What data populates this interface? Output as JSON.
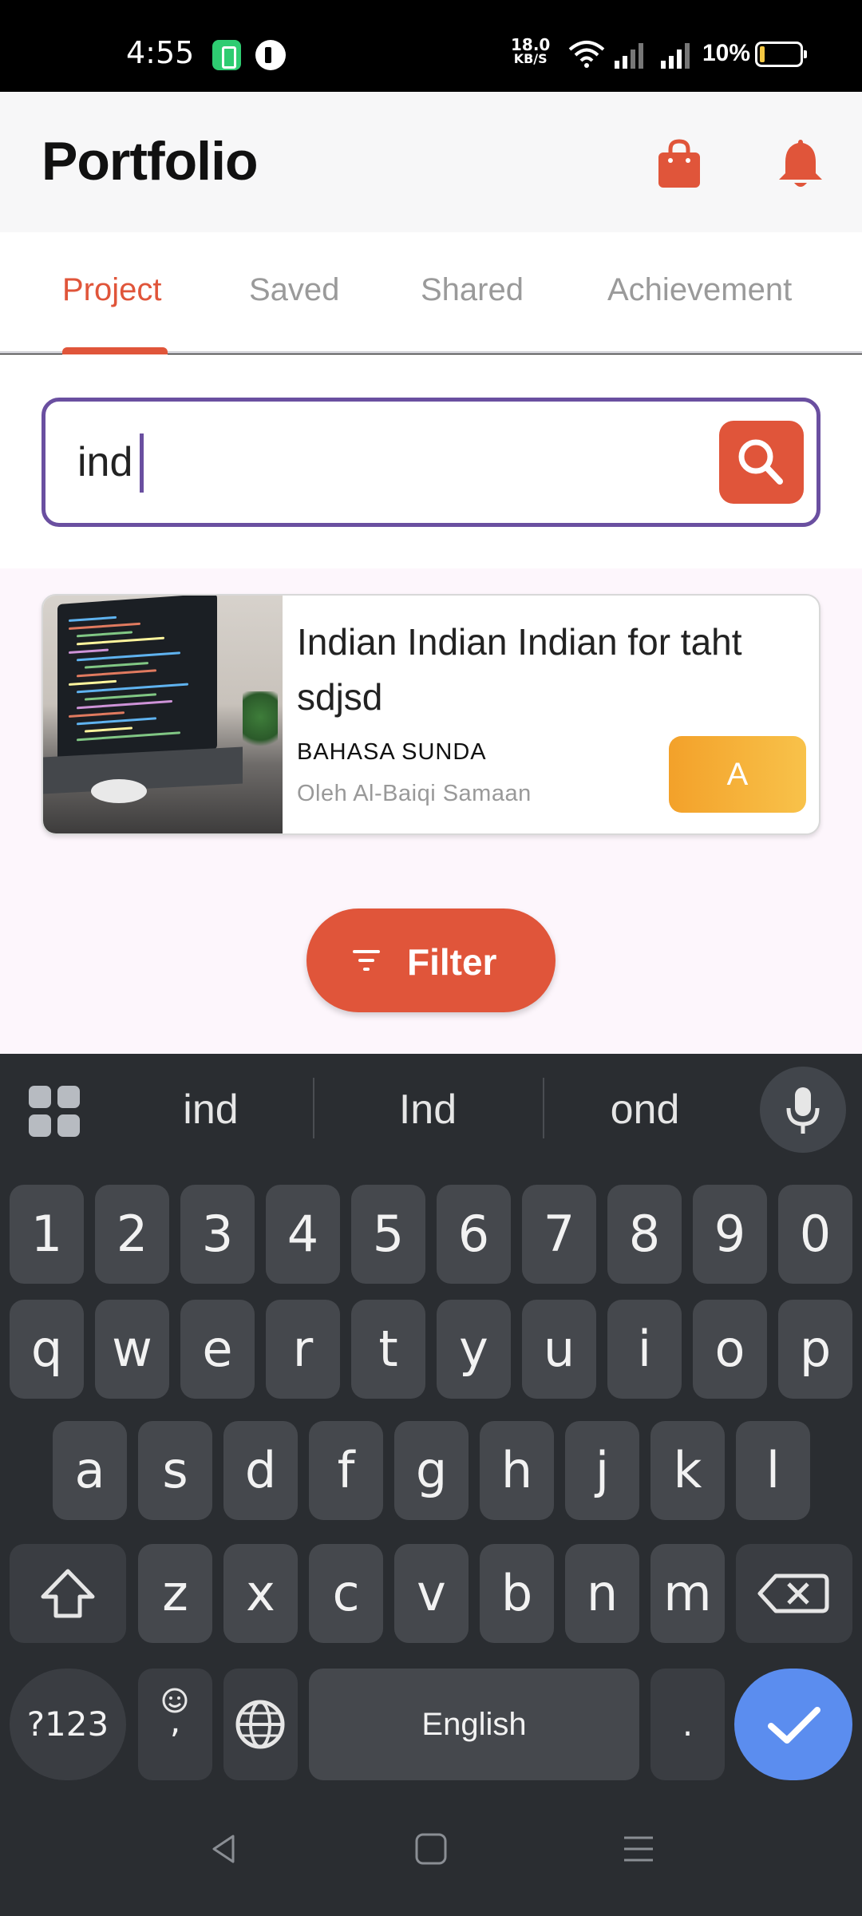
{
  "status_bar": {
    "time": "4:55",
    "net_speed_value": "18.0",
    "net_speed_unit": "KB/S",
    "battery_percent": "10%"
  },
  "app_bar": {
    "title": "Portfolio",
    "icons": [
      "shopping-bag-icon",
      "bell-icon"
    ],
    "accent_color": "#e0553a"
  },
  "tabs": [
    {
      "label": "Project",
      "active": true
    },
    {
      "label": "Saved",
      "active": false
    },
    {
      "label": "Shared",
      "active": false
    },
    {
      "label": "Achievement",
      "active": false
    }
  ],
  "search": {
    "value": "ind",
    "border_color": "#6a4fa0"
  },
  "results": [
    {
      "title": "Indian Indian Indian for taht sdjsd",
      "subject": "BAHASA SUNDA",
      "author": "Oleh Al-Baiqi Samaan",
      "grade": "A"
    }
  ],
  "filter_button": {
    "label": "Filter"
  },
  "keyboard": {
    "suggestions": [
      "ind",
      "Ind",
      "ond"
    ],
    "row_numbers": [
      "1",
      "2",
      "3",
      "4",
      "5",
      "6",
      "7",
      "8",
      "9",
      "0"
    ],
    "row_1": [
      "q",
      "w",
      "e",
      "r",
      "t",
      "y",
      "u",
      "i",
      "o",
      "p"
    ],
    "row_2": [
      "a",
      "s",
      "d",
      "f",
      "g",
      "h",
      "j",
      "k",
      "l"
    ],
    "row_3": [
      "z",
      "x",
      "c",
      "v",
      "b",
      "n",
      "m"
    ],
    "symbols_key": "?123",
    "emoji_comma_key": ",",
    "space_label": "English",
    "period_key": ".",
    "enter_color": "#5b8def"
  }
}
